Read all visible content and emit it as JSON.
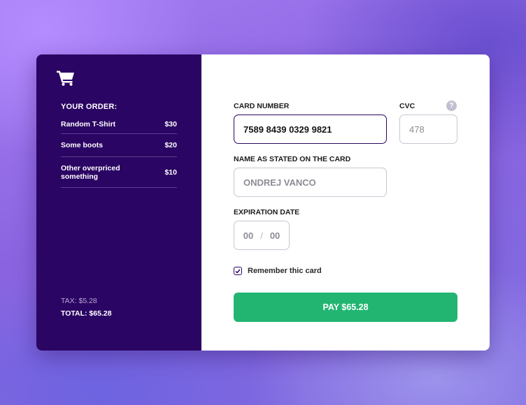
{
  "order": {
    "icon": "shopping-cart-icon",
    "title": "YOUR ORDER:",
    "items": [
      {
        "name": "Random T-Shirt",
        "price": "$30"
      },
      {
        "name": "Some boots",
        "price": "$20"
      },
      {
        "name": "Other overpriced something",
        "price": "$10"
      }
    ],
    "tax": "TAX: $5.28",
    "total": "TOTAL: $65.28"
  },
  "form": {
    "card_number": {
      "label": "CARD NUMBER",
      "value": "7589 8439 0329 9821"
    },
    "cvc": {
      "label": "CVC",
      "placeholder": "478",
      "help_icon": "question-icon",
      "help_text": "?"
    },
    "name": {
      "label": "NAME AS STATED ON THE CARD",
      "placeholder": "ONDREJ VANCO"
    },
    "expiration": {
      "label": "EXPIRATION DATE",
      "month": "00",
      "separator": "/",
      "year": "00"
    },
    "remember": {
      "label": "Remember thic card",
      "checked": true,
      "icon": "check-icon"
    },
    "pay_button": "PAY $65.28"
  },
  "colors": {
    "sidebar": "#2b0563",
    "accent": "#22b572",
    "card": "#ffffff"
  }
}
